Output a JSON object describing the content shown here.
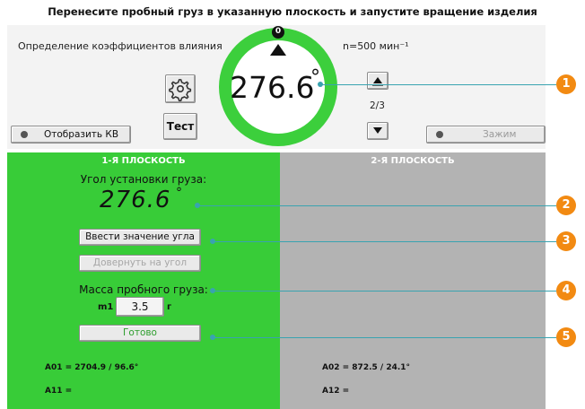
{
  "title": "Перенесите пробный груз в указанную плоскость и запустите вращение изделия",
  "top": {
    "mode_label": "Определение коэффициентов влияния",
    "speed_label": "n=500 мин⁻¹",
    "angle": "276.6",
    "degree": "°",
    "compass_mark": "0",
    "test_button": "Тест",
    "page_indicator": "2/3",
    "show_kv_button": "Отобразить КВ",
    "clamp_button": "Зажим"
  },
  "plane1": {
    "title": "1-Я ПЛОСКОСТЬ",
    "angle_caption": "Угол установки груза:",
    "angle_value": "276.6",
    "degree": "°",
    "enter_angle_button": "Ввести значение угла",
    "rotate_button": "Довернуть на угол",
    "mass_caption": "Масса пробного груза:",
    "mass_label": "m1",
    "mass_value": "3.5",
    "mass_unit": "г",
    "ready_button": "Готово",
    "a01": "A01 = 2704.9 / 96.6°",
    "a11": "A11 ="
  },
  "plane2": {
    "title": "2-Я ПЛОСКОСТЬ",
    "a02": "A02 = 872.5 / 24.1°",
    "a12": "A12 ="
  },
  "callouts": [
    "1",
    "2",
    "3",
    "4",
    "5"
  ],
  "colors": {
    "active_plane": "#38cc38",
    "inactive_plane": "#b3b3b3",
    "ring": "#3ccf3c",
    "callout": "#f28a12",
    "leader": "#39a3b0"
  }
}
